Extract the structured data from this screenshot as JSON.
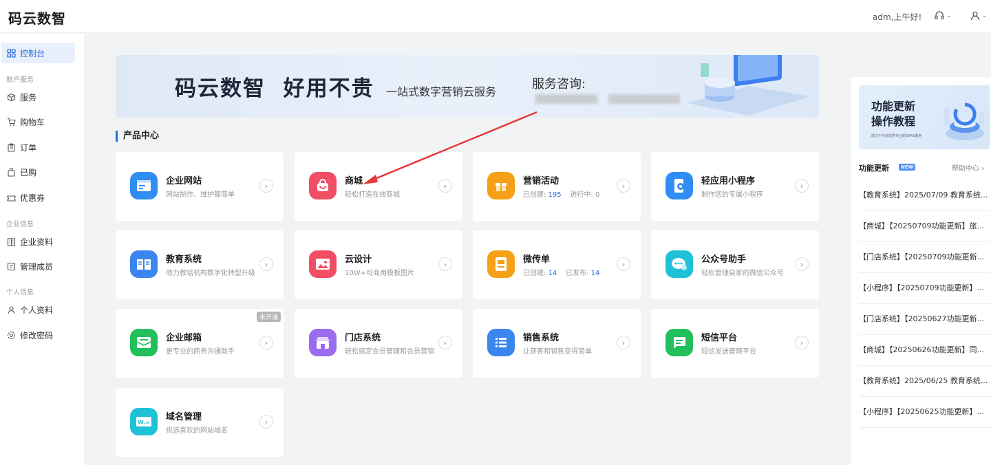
{
  "app": {
    "title": "码云数智"
  },
  "header": {
    "greeting": "adm,上午好!",
    "support_icon": "headset-icon",
    "user_icon": "user-icon"
  },
  "sidebar": {
    "dashboard": "控制台",
    "groups": [
      "账户服务",
      "企业信息",
      "个人信息"
    ],
    "account": [
      "服务",
      "购物车",
      "订单",
      "已购",
      "优惠券"
    ],
    "company": [
      "企业资料",
      "管理成员"
    ],
    "personal": [
      "个人资料",
      "修改密码"
    ]
  },
  "banner": {
    "brand": "码云数智  好用不贵",
    "subtitle": "一站式数字营销云服务",
    "consult": "服务咨询:"
  },
  "section": {
    "title": "产品中心"
  },
  "products": [
    {
      "title": "企业网站",
      "desc": "网站制作、维护都简单",
      "icon": "website-icon",
      "color": "#2f8df3"
    },
    {
      "title": "商城",
      "desc": "轻松打造在线商城",
      "icon": "shopping-bag-icon",
      "color": "#f24e63"
    },
    {
      "title": "营销活动",
      "created_label": "已创建:",
      "created": "195",
      "running_label": "进行中:",
      "running": "0",
      "icon": "gift-icon",
      "color": "#f5a017"
    },
    {
      "title": "轻应用小程序",
      "desc": "制作您的专属小程序",
      "icon": "mini-program-icon",
      "color": "#2f8df3"
    },
    {
      "title": "教育系统",
      "desc": "助力教培机构数字化转型升级",
      "icon": "book-icon",
      "color": "#3a86ee"
    },
    {
      "title": "云设计",
      "desc": "10W+可商用模板图片",
      "icon": "image-icon",
      "color": "#f24e63"
    },
    {
      "title": "微传单",
      "created_label": "已创建:",
      "created": "14",
      "published_label": "已发布:",
      "published": "14",
      "icon": "flyer-icon",
      "color": "#f5a017"
    },
    {
      "title": "公众号助手",
      "desc": "轻松管理自家的微信公众号",
      "icon": "wechat-icon",
      "color": "#1fc1d6"
    },
    {
      "title": "企业邮箱",
      "desc": "更专业的商务沟通助手",
      "icon": "mail-icon",
      "color": "#22c05a",
      "badge": "未开通"
    },
    {
      "title": "门店系统",
      "desc": "轻松搞定会员管理和会员营销",
      "icon": "store-icon",
      "color": "#9b6cf0"
    },
    {
      "title": "销售系统",
      "desc": "让获客和销售变得简单",
      "icon": "list-icon",
      "color": "#3a86ee"
    },
    {
      "title": "短信平台",
      "desc": "短信发送管理平台",
      "icon": "sms-icon",
      "color": "#22c05a"
    },
    {
      "title": "域名管理",
      "desc": "挑选喜欢的网站域名",
      "icon": "domain-icon",
      "color": "#1fc1d6"
    }
  ],
  "tutorial": {
    "title": "功能更新\n操作教程",
    "subtitle": "助力于为您提供专业的SAAS服务"
  },
  "updates": {
    "title": "功能更新",
    "badge": "NEW",
    "help": "帮助中心",
    "items": [
      "【教育系统】2025/07/09 教育系统...",
      "【商城】【20250709功能更新】旅...",
      "【门店系统】【20250709功能更新...",
      "【小程序】【20250709功能更新】...",
      "【门店系统】【20250627功能更新...",
      "【商城】【20250626功能更新】同...",
      "【教育系统】2025/06/25 教育系统...",
      "【小程序】【20250625功能更新】..."
    ]
  },
  "colors": {
    "accent": "#2a6fd8",
    "annotation_arrow": "#e8373a"
  }
}
